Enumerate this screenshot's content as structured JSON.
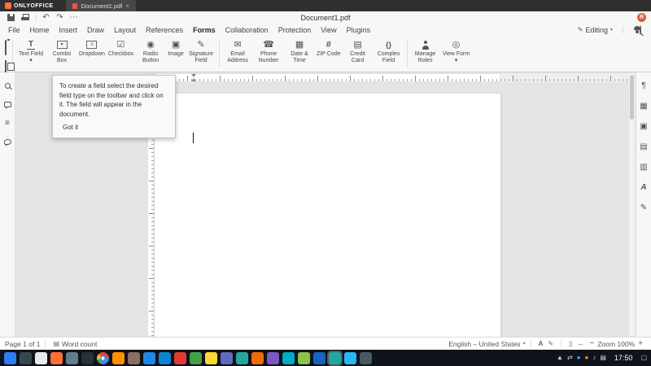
{
  "colors": {
    "accent": "#ff6f3d",
    "avatar": "#e2583e"
  },
  "titlebar": {
    "app_name": "ONLYOFFICE",
    "tab_label": "Document1.pdf",
    "close_glyph": "×"
  },
  "quickbar": {
    "document_title": "Document1.pdf",
    "undo_glyph": "↶",
    "redo_glyph": "↷",
    "more_glyph": "⋯",
    "avatar_initial": "R"
  },
  "menubar": {
    "items": [
      {
        "label": "File"
      },
      {
        "label": "Home"
      },
      {
        "label": "Insert"
      },
      {
        "label": "Draw"
      },
      {
        "label": "Layout"
      },
      {
        "label": "References"
      },
      {
        "label": "Forms"
      },
      {
        "label": "Collaboration"
      },
      {
        "label": "Protection"
      },
      {
        "label": "View"
      },
      {
        "label": "Plugins"
      }
    ],
    "active_item": "Forms",
    "mode": {
      "label": "Editing",
      "pencil_glyph": "✎",
      "caret_glyph": "▾"
    }
  },
  "toolbar": {
    "buttons": [
      {
        "label": "Text Field ▾",
        "glyph": "T"
      },
      {
        "label": "Combo Box",
        "glyph": "▾"
      },
      {
        "label": "Dropdown",
        "glyph": "≡"
      },
      {
        "label": "Checkbox",
        "glyph": "☑"
      },
      {
        "label": "Radio Button",
        "glyph": "◉"
      },
      {
        "label": "Image",
        "glyph": "▣"
      },
      {
        "label": "Signature Field",
        "glyph": "✎"
      },
      {
        "label": "Email Address",
        "glyph": "✉"
      },
      {
        "label": "Phone Number",
        "glyph": "☎"
      },
      {
        "label": "Date & Time",
        "glyph": "▦"
      },
      {
        "label": "ZIP Code",
        "glyph": "#"
      },
      {
        "label": "Credit Card",
        "glyph": "▤"
      },
      {
        "label": "Complex Field",
        "glyph": "{}"
      },
      {
        "label": "Manage Roles",
        "glyph": ""
      },
      {
        "label": "View Form ▾",
        "glyph": "◎"
      }
    ]
  },
  "tooltip": {
    "text": "To create a field select the desired field type on the toolbar and click on it. The field will appear in the document.",
    "button_label": "Got it"
  },
  "left_sidebar": {
    "icons": [
      {
        "name": "search"
      },
      {
        "name": "comments"
      },
      {
        "name": "navigation",
        "glyph": "≡"
      },
      {
        "name": "feedback"
      }
    ]
  },
  "right_sidebar": {
    "icons": [
      {
        "name": "paragraph-settings",
        "glyph": "¶"
      },
      {
        "name": "table-settings",
        "glyph": "▦"
      },
      {
        "name": "image-settings",
        "glyph": "▣"
      },
      {
        "name": "header-footer-settings",
        "glyph": "▤"
      },
      {
        "name": "chart-settings",
        "glyph": "▥"
      },
      {
        "name": "textart-settings",
        "glyph": "A"
      },
      {
        "name": "signature-settings",
        "glyph": "✎"
      }
    ]
  },
  "statusbar": {
    "page_label": "Page 1 of 1",
    "word_count_glyph": "▤",
    "word_count_label": "Word count",
    "language": "English – United States",
    "caret_glyph": "▾",
    "spellcheck_glyph": "A",
    "review_glyph": "✎",
    "fit_page_glyph": "▯",
    "fit_width_glyph": "↔",
    "zoom_out_glyph": "−",
    "zoom_label": "Zoom 100%",
    "zoom_in_glyph": "+"
  },
  "taskbar": {
    "time": "17:50",
    "after_time_glyph": "▢",
    "apps": [
      {
        "name": "apps-menu",
        "color": "#2d7df6"
      },
      {
        "name": "file-manager",
        "color": "#37474f"
      },
      {
        "name": "text-editor",
        "color": "#e8eaed"
      },
      {
        "name": "firefox",
        "color": "#ff7139"
      },
      {
        "name": "system-settings",
        "color": "#607d8b"
      },
      {
        "name": "terminal",
        "color": "#263238"
      },
      {
        "name": "chrome",
        "color": "#ffffff",
        "special": "chrome"
      },
      {
        "name": "vlc",
        "color": "#ff8f00"
      },
      {
        "name": "gimp",
        "color": "#8d6e63"
      },
      {
        "name": "libreoffice",
        "color": "#1e88e5"
      },
      {
        "name": "thunderbird",
        "color": "#0a84d0"
      },
      {
        "name": "mail",
        "color": "#e53935"
      },
      {
        "name": "calculator",
        "color": "#43a047"
      },
      {
        "name": "notes",
        "color": "#fdd835"
      },
      {
        "name": "ide",
        "color": "#5c6bc0"
      },
      {
        "name": "player",
        "color": "#26a69a"
      },
      {
        "name": "blender",
        "color": "#ef6c00"
      },
      {
        "name": "viewer",
        "color": "#7e57c2"
      },
      {
        "name": "messenger",
        "color": "#00acc1"
      },
      {
        "name": "screenshot-tool",
        "color": "#8bc34a"
      },
      {
        "name": "dev-tools",
        "color": "#1565c0"
      },
      {
        "name": "onlyoffice",
        "color": "#1fa8a0",
        "active": true
      },
      {
        "name": "telegram",
        "color": "#29b6f6"
      },
      {
        "name": "system-monitor",
        "color": "#455a64"
      }
    ],
    "tray": [
      {
        "name": "tray-expand",
        "glyph": "▲",
        "color": "#cfd8dc"
      },
      {
        "name": "network",
        "glyph": "⇄",
        "color": "#cfd8dc"
      },
      {
        "name": "messenger-tray",
        "glyph": "●",
        "color": "#29b6f6"
      },
      {
        "name": "updates",
        "glyph": "●",
        "color": "#ff9800"
      },
      {
        "name": "volume",
        "glyph": "♪",
        "color": "#cfd8dc"
      },
      {
        "name": "clipboard-tray",
        "glyph": "▤",
        "color": "#cfd8dc"
      }
    ]
  }
}
